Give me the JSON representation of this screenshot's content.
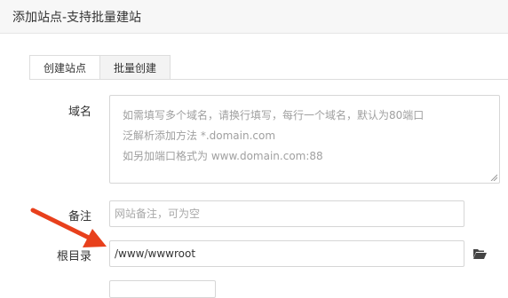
{
  "window": {
    "title": "添加站点-支持批量建站"
  },
  "tabs": [
    {
      "label": "创建站点",
      "active": true
    },
    {
      "label": "批量创建",
      "active": false
    }
  ],
  "form": {
    "domain": {
      "label": "域名",
      "placeholder_lines": [
        "如需填写多个域名，请换行填写，每行一个域名，默认为80端口",
        "泛解析添加方法 *.domain.com",
        "如另加端口格式为 www.domain.com:88"
      ]
    },
    "remark": {
      "label": "备注",
      "placeholder": "网站备注，可为空"
    },
    "root": {
      "label": "根目录",
      "value": "/www/wwwroot",
      "browse_icon": "folder-open-icon"
    }
  },
  "annotation": {
    "arrow_color": "#e8401c"
  }
}
